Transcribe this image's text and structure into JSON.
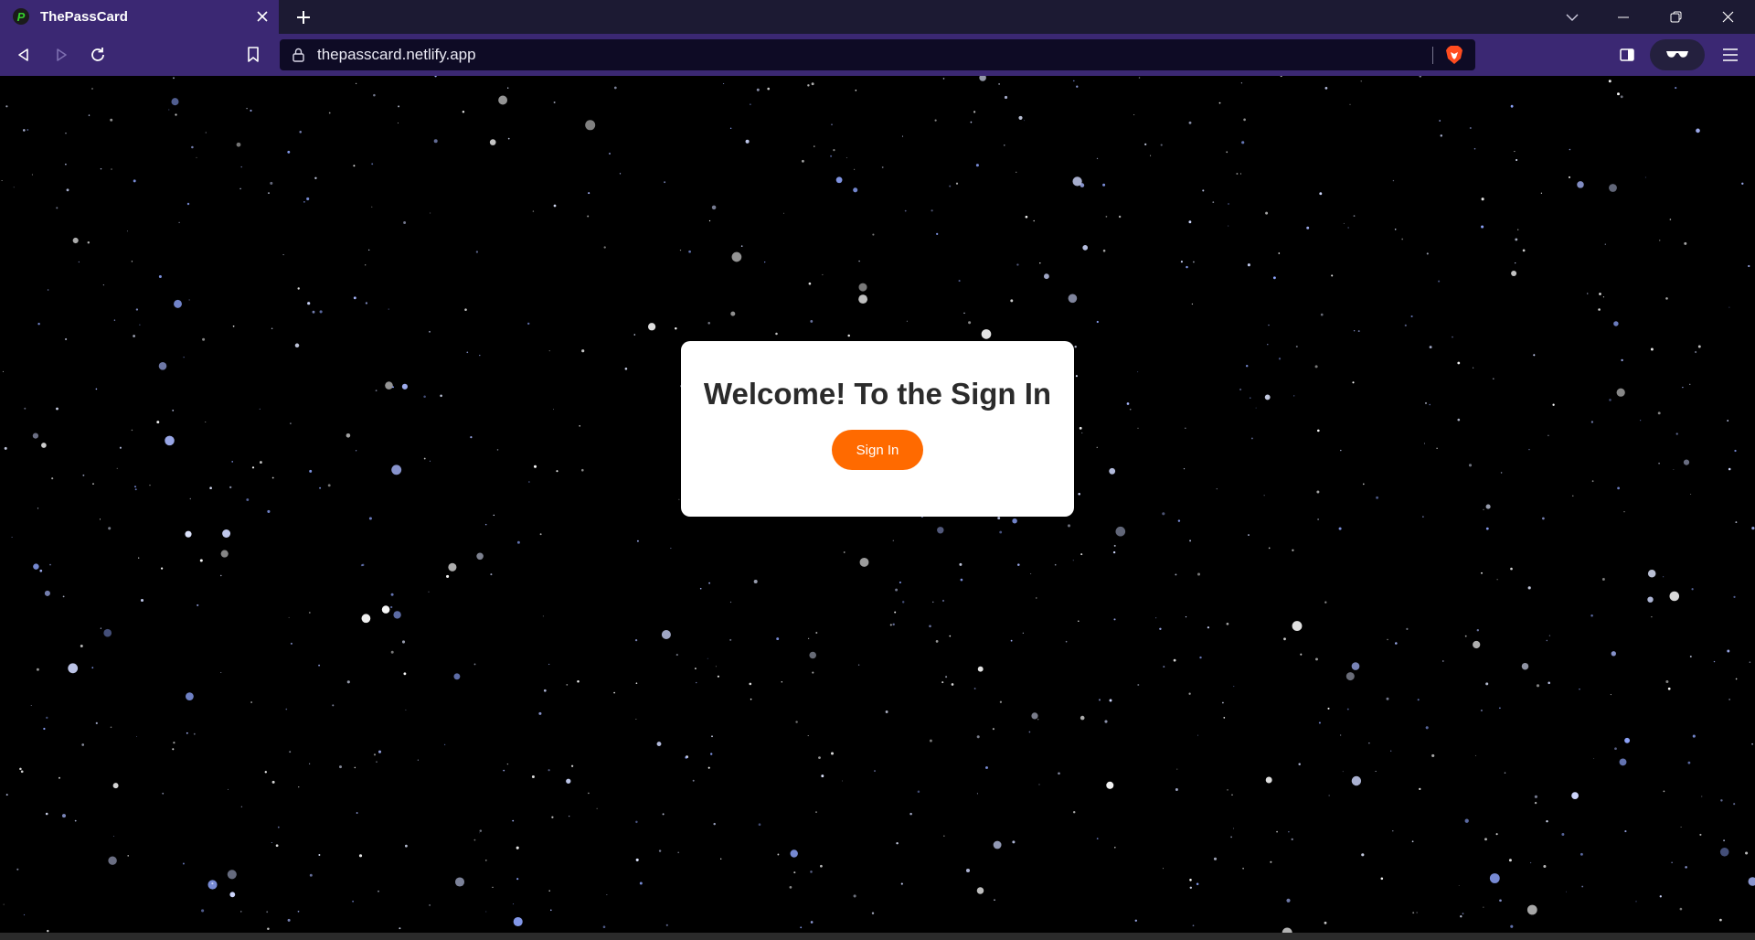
{
  "browser": {
    "tab_title": "ThePassCard",
    "url": "thepasscard.netlify.app",
    "favicon_letter": "P"
  },
  "page": {
    "heading": "Welcome! To the Sign In",
    "signin_label": "Sign In"
  },
  "colors": {
    "accent": "#ff6a00",
    "toolbar": "#3b2873",
    "page_background": "#000000"
  },
  "icons": {
    "back": "back-arrow-icon",
    "forward": "forward-arrow-icon",
    "reload": "reload-icon",
    "bookmark": "bookmark-icon",
    "lock": "lock-icon",
    "brave": "brave-lion-icon",
    "sidebar": "sidebar-icon",
    "shields": "glasses-icon",
    "menu": "hamburger-menu-icon"
  }
}
